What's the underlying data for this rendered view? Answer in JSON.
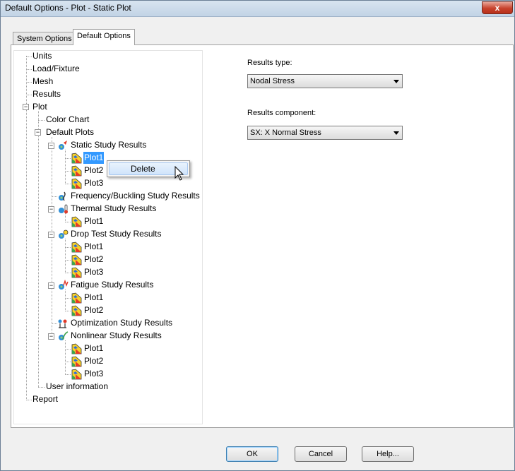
{
  "window": {
    "title": "Default Options - Plot - Static Plot",
    "close_label": "x"
  },
  "tabs": [
    {
      "label": "System Options",
      "active": false
    },
    {
      "label": "Default Options",
      "active": true
    }
  ],
  "tree": {
    "units": "Units",
    "load_fixture": "Load/Fixture",
    "mesh": "Mesh",
    "results": "Results",
    "plot": "Plot",
    "color_chart": "Color Chart",
    "default_plots": "Default Plots",
    "static": {
      "label": "Static Study Results",
      "plots": [
        "Plot1",
        "Plot2",
        "Plot3"
      ]
    },
    "frequency": {
      "label": "Frequency/Buckling Study Results"
    },
    "thermal": {
      "label": "Thermal Study Results",
      "plots": [
        "Plot1"
      ]
    },
    "drop_test": {
      "label": "Drop Test Study Results",
      "plots": [
        "Plot1",
        "Plot2",
        "Plot3"
      ]
    },
    "fatigue": {
      "label": "Fatigue Study Results",
      "plots": [
        "Plot1",
        "Plot2"
      ]
    },
    "optimization": {
      "label": "Optimization Study Results"
    },
    "nonlinear": {
      "label": "Nonlinear Study Results",
      "plots": [
        "Plot1",
        "Plot2",
        "Plot3"
      ]
    },
    "user_information": "User information",
    "report": "Report",
    "selected_item": "Static Study Results > Plot1"
  },
  "context_menu": {
    "items": [
      "Delete"
    ]
  },
  "form": {
    "results_type_label": "Results type:",
    "results_type_value": "Nodal Stress",
    "results_component_label": "Results component:",
    "results_component_value": "SX: X Normal Stress"
  },
  "buttons": {
    "ok": "OK",
    "cancel": "Cancel",
    "help": "Help..."
  },
  "colors": {
    "selection": "#3399ff",
    "dialog_bg": "#f0f0f0"
  }
}
